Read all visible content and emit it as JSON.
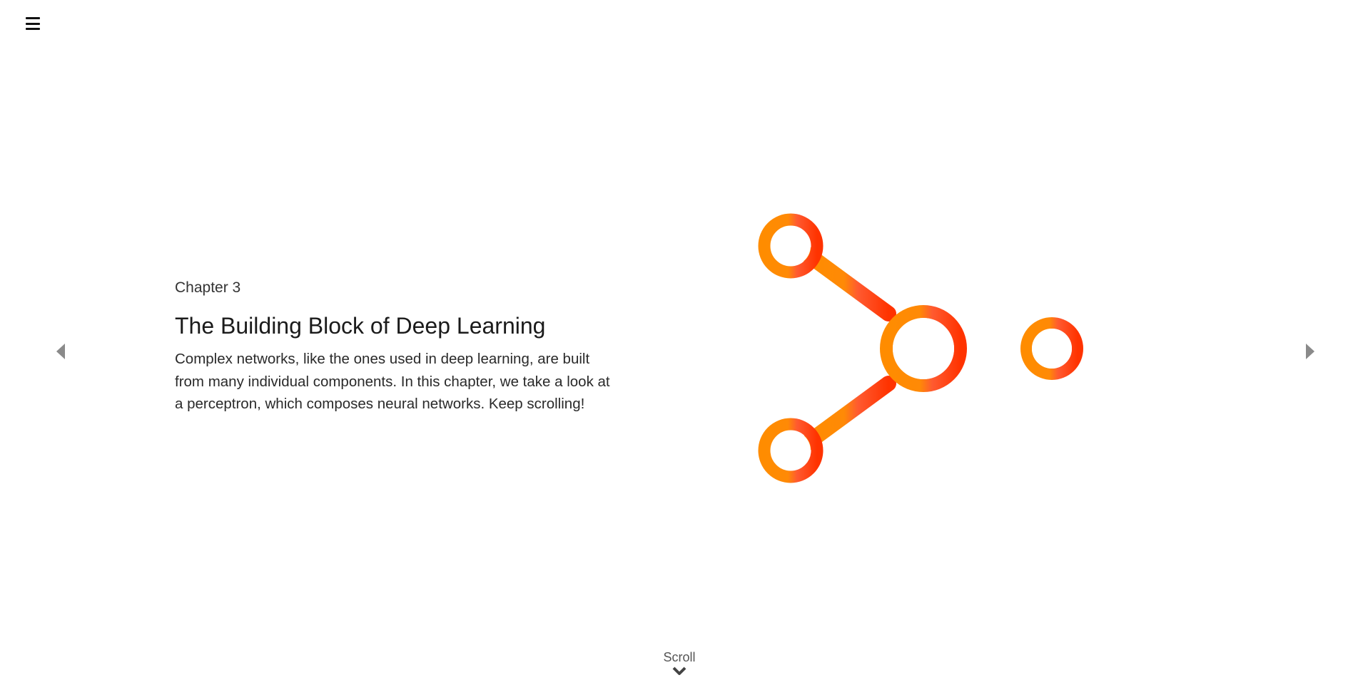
{
  "header": {
    "menu_icon": "hamburger-menu-icon"
  },
  "navigation": {
    "prev_icon": "caret-left-icon",
    "next_icon": "caret-right-icon",
    "arrow_color": "#8a8a8a"
  },
  "chapter": {
    "label": "Chapter 3",
    "title": "The Building Block of Deep Learning",
    "description": "Complex networks, like the ones used in deep learning, are built from many individual components. In this chapter, we take a look at a perceptron, which composes neural networks. Keep scrolling!"
  },
  "graphic": {
    "icon": "perceptron-network-icon",
    "gradient_start": "#ff8c00",
    "gradient_end": "#ff3300"
  },
  "scroll": {
    "label": "Scroll",
    "icon": "chevron-down-icon"
  }
}
